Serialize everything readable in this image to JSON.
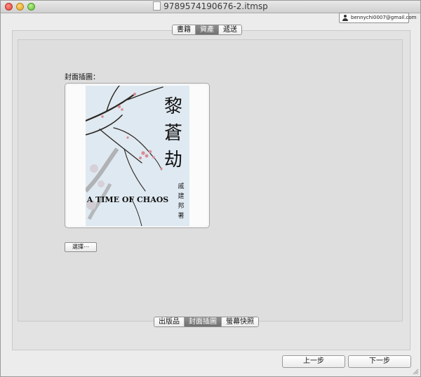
{
  "window": {
    "title": "9789574190676-2.itmsp"
  },
  "account": {
    "email": "bennychi0007@gmail.com"
  },
  "top_tabs": [
    {
      "label": "書籍",
      "selected": false
    },
    {
      "label": "資產",
      "selected": true
    },
    {
      "label": "遞送",
      "selected": false
    }
  ],
  "cover": {
    "label": "封面插圖：",
    "image": {
      "title_chars": [
        "黎",
        "蒼",
        "劫"
      ],
      "english_title": "A TIME OF CHAOS",
      "author_chars": [
        "戚",
        "建",
        "邦",
        "著"
      ],
      "background_color": "#dfe9f1",
      "blossom_color": "#d98b97",
      "branch_color": "#2b2621"
    },
    "choose_button": "選擇⋯"
  },
  "bottom_tabs": [
    {
      "label": "出版品",
      "selected": false
    },
    {
      "label": "封面插圖",
      "selected": true
    },
    {
      "label": "螢幕快照",
      "selected": false
    }
  ],
  "nav": {
    "prev": "上一步",
    "next": "下一步"
  }
}
